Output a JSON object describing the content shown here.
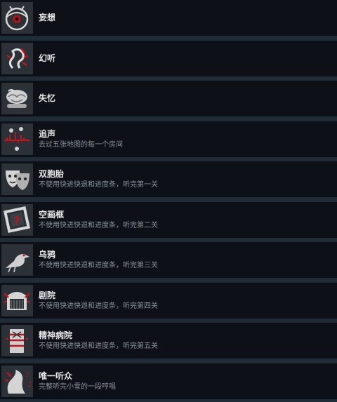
{
  "achievements": [
    {
      "title": "妄想",
      "desc": "",
      "icon": "eye-icon"
    },
    {
      "title": "幻听",
      "desc": "",
      "icon": "ear-icon"
    },
    {
      "title": "失忆",
      "desc": "",
      "icon": "brain-icon"
    },
    {
      "title": "追声",
      "desc": "去过五张地图的每一个房间",
      "icon": "soundwave-icon"
    },
    {
      "title": "双胞胎",
      "desc": "不使用快进快退和进度条，听完第一关",
      "icon": "theater-masks-icon"
    },
    {
      "title": "空画框",
      "desc": "不使用快进快退和进度条，听完第二关",
      "icon": "picture-frame-icon"
    },
    {
      "title": "乌鸦",
      "desc": "不使用快进快退和进度条，听完第三关",
      "icon": "crow-icon"
    },
    {
      "title": "剧院",
      "desc": "不使用快进快退和进度条，听完第四关",
      "icon": "theater-icon"
    },
    {
      "title": "精神病院",
      "desc": "不使用快进快退和进度条，听完第五关",
      "icon": "asylum-icon"
    },
    {
      "title": "唯一听众",
      "desc": "完整听完小雪的一段哼唱",
      "icon": "listener-icon"
    }
  ]
}
